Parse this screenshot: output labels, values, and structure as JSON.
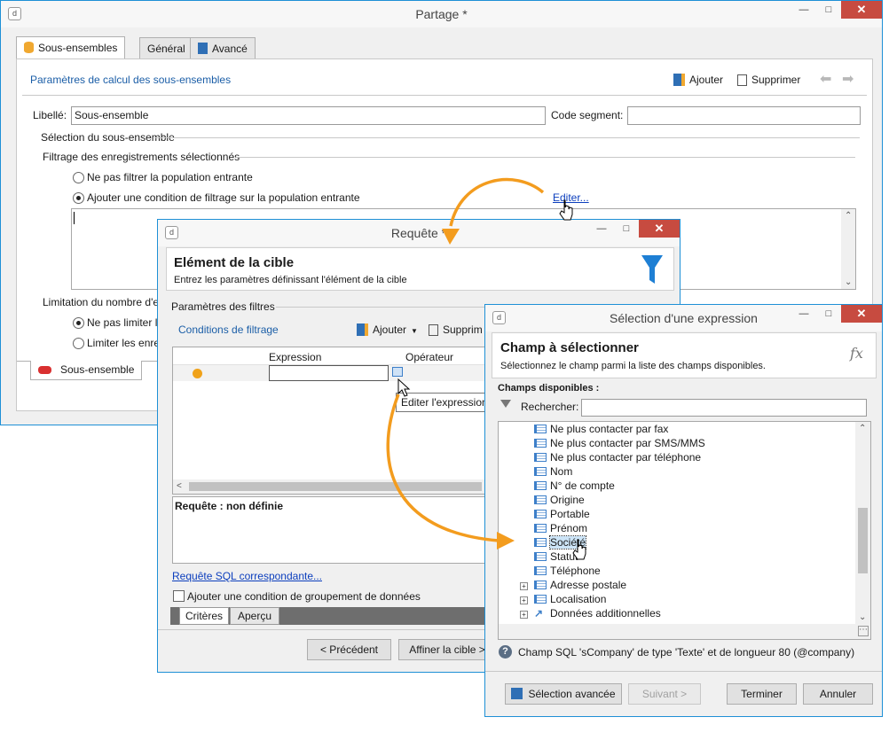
{
  "partage": {
    "title": "Partage *",
    "tabs": [
      "Sous-ensembles",
      "Général",
      "Avancé"
    ],
    "header": "Paramètres de calcul des sous-ensembles",
    "add_label": "Ajouter",
    "delete_label": "Supprimer",
    "libelle_label": "Libellé:",
    "libelle_value": "Sous-ensemble",
    "code_label": "Code segment:",
    "code_value": "",
    "selection_group": "Sélection du sous-ensemble",
    "filter_group": "Filtrage des enregistrements sélectionnés",
    "radio_no_filter": "Ne pas filtrer la population entrante",
    "radio_add_condition": "Ajouter une condition de filtrage sur la population entrante",
    "edit_link": "Editer...",
    "limit_group": "Limitation du nombre d'e",
    "radio_no_limit": "Ne pas limiter le",
    "radio_limit": "Limiter les enreg",
    "bottom_tab": "Sous-ensemble"
  },
  "requete": {
    "title": "Requête *",
    "heading": "Elément de la cible",
    "subheading": "Entrez les paramètres définissant l'élément de la cible",
    "filter_params": "Paramètres des filtres",
    "conditions_label": "Conditions de filtrage",
    "add_label": "Ajouter",
    "delete_label": "Supprim",
    "col_expression": "Expression",
    "col_operator": "Opérateur",
    "tooltip": "Editer l'expression",
    "query_status": "Requête : non définie",
    "sql_link": "Requête SQL correspondante...",
    "group_check": "Ajouter une condition de groupement de données",
    "tabs": [
      "Critères",
      "Aperçu"
    ],
    "prev_btn": "< Précédent",
    "refine_btn": "Affiner la cible >"
  },
  "selection": {
    "title": "Sélection d'une expression",
    "heading": "Champ à sélectionner",
    "subheading": "Sélectionnez le champ parmi la liste des champs disponibles.",
    "fx": "fx",
    "available": "Champs disponibles :",
    "search_label": "Rechercher:",
    "search_value": "",
    "fields": [
      "Ne plus contacter par fax",
      "Ne plus contacter par SMS/MMS",
      "Ne plus contacter par téléphone",
      "Nom",
      "N° de compte",
      "Origine",
      "Portable",
      "Prénom",
      "Société",
      "Statut",
      "Téléphone"
    ],
    "groups": [
      "Adresse postale",
      "Localisation",
      "Données additionnelles"
    ],
    "info": "Champ SQL 'sCompany' de type 'Texte' et de longueur 80 (@company)",
    "advanced_btn": "Sélection avancée",
    "next_btn": "Suivant >",
    "finish_btn": "Terminer",
    "cancel_btn": "Annuler"
  },
  "colors": {
    "accent": "#1e90d6",
    "arrow": "#f39c1e",
    "close": "#c74b40",
    "link": "#0b3ebd",
    "header_blue": "#1b5ea7",
    "selected": "#cce4f7"
  }
}
